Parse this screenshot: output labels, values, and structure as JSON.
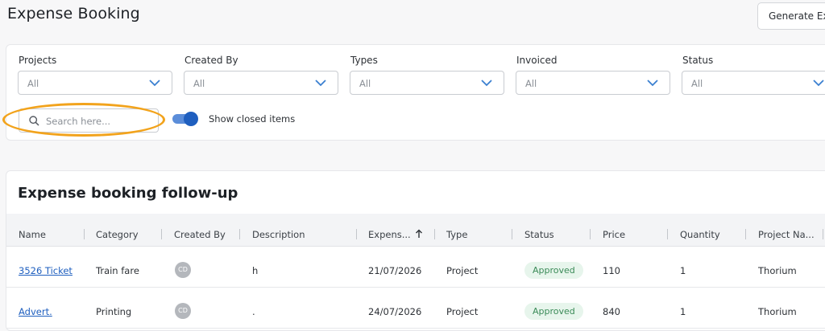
{
  "header": {
    "title": "Expense Booking",
    "generate_button": "Generate Ex"
  },
  "filters": {
    "items": [
      {
        "label": "Projects",
        "value": "All"
      },
      {
        "label": "Created By",
        "value": "All"
      },
      {
        "label": "Types",
        "value": "All"
      },
      {
        "label": "Invoiced",
        "value": "All"
      },
      {
        "label": "Status",
        "value": "All"
      }
    ],
    "search_placeholder": "Search here...",
    "show_closed_label": "Show closed items",
    "show_closed_on": true
  },
  "table": {
    "title": "Expense booking follow-up",
    "columns": [
      "Name",
      "Category",
      "Created By",
      "Description",
      "Expens...",
      "Type",
      "Status",
      "Price",
      "Quantity",
      "Project Na..."
    ],
    "rows": [
      {
        "name": "3526 Ticket",
        "category": "Train fare",
        "created_by": "CD",
        "description": "h",
        "expense_date": "21/07/2026",
        "type": "Project",
        "status": "Approved",
        "price": "110",
        "quantity": "1",
        "project": "Thorium"
      },
      {
        "name": "Advert.",
        "category": "Printing",
        "created_by": "CD",
        "description": ".",
        "expense_date": "24/07/2026",
        "type": "Project",
        "status": "Approved",
        "price": "840",
        "quantity": "1",
        "project": "Thorium"
      }
    ]
  },
  "colors": {
    "accent": "#1f5fbf",
    "highlight": "#f2a31c",
    "approved_bg": "#e7f5ec",
    "approved_text": "#3a8a57"
  },
  "icons": {
    "dropdown": "chevron-down-icon",
    "search": "search-icon",
    "sort": "arrow-up-icon"
  }
}
